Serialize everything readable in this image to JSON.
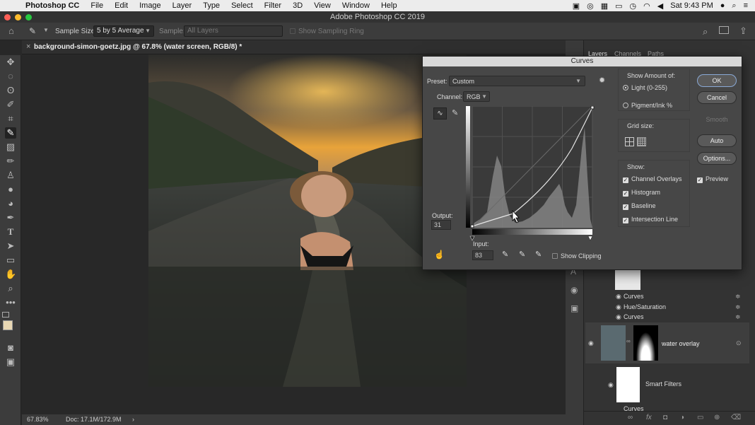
{
  "menubar": {
    "app": "Photoshop CC",
    "items": [
      "File",
      "Edit",
      "Image",
      "Layer",
      "Type",
      "Select",
      "Filter",
      "3D",
      "View",
      "Window",
      "Help"
    ],
    "clock": "Sat 9:43 PM"
  },
  "window": {
    "title": "Adobe Photoshop CC 2019"
  },
  "options_bar": {
    "sample_size_label": "Sample Size:",
    "sample_size_value": "5 by 5 Average",
    "sample_label": "Sample:",
    "sample_value": "All Layers",
    "sampling_ring": "Show Sampling Ring"
  },
  "document": {
    "tab": "background-simon-goetz.jpg @ 67.8% (water screen, RGB/8) *",
    "zoom": "67.83%",
    "doc_size": "Doc: 17.1M/172.9M"
  },
  "panels": {
    "tabs": [
      "Layers",
      "Channels",
      "Paths"
    ],
    "layers": [
      {
        "name": "Curves"
      },
      {
        "name": "Hue/Saturation"
      },
      {
        "name": "Curves"
      },
      {
        "name": "water overlay"
      },
      {
        "name": "Smart Filters"
      },
      {
        "name": "Curves"
      }
    ]
  },
  "curves": {
    "title": "Curves",
    "preset_label": "Preset:",
    "preset_value": "Custom",
    "channel_label": "Channel:",
    "channel_value": "RGB",
    "output_label": "Output:",
    "output_value": "31",
    "input_label": "Input:",
    "input_value": "83",
    "show_clipping": "Show Clipping",
    "show_amount_label": "Show Amount of:",
    "light_option": "Light  (0-255)",
    "pigment_option": "Pigment/Ink %",
    "grid_size_label": "Grid size:",
    "show_label": "Show:",
    "checks": [
      "Channel Overlays",
      "Histogram",
      "Baseline",
      "Intersection Line"
    ],
    "buttons": {
      "ok": "OK",
      "cancel": "Cancel",
      "smooth": "Smooth",
      "auto": "Auto",
      "options": "Options..."
    },
    "preview": "Preview"
  },
  "colors": {
    "accent": "#8aa9d6",
    "dialog_bg": "#474747",
    "panel_bg": "#333333"
  }
}
